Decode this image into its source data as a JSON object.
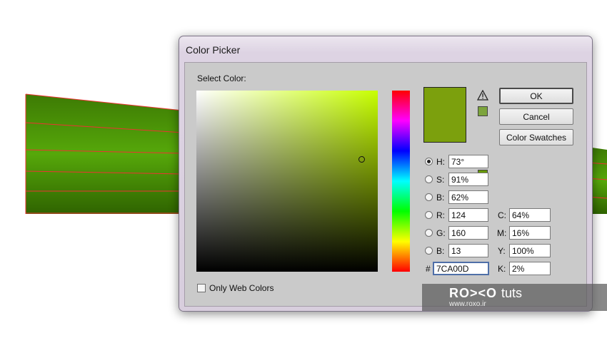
{
  "window": {
    "title": "Color Picker"
  },
  "picker": {
    "select_label": "Select Color:",
    "new_color": "#7CA00D",
    "gamut_swatch": "#7CA43C",
    "web_swatch": "#669900",
    "hue_deg": 73,
    "saturation_pct": 91,
    "brightness_pct": 62
  },
  "buttons": {
    "ok": "OK",
    "cancel": "Cancel",
    "swatches": "Color Swatches"
  },
  "hsb": {
    "h_label": "H:",
    "h_value": "73°",
    "s_label": "S:",
    "s_value": "91%",
    "b_label": "B:",
    "b_value": "62%"
  },
  "rgb": {
    "r_label": "R:",
    "r_value": "124",
    "g_label": "G:",
    "g_value": "160",
    "b_label": "B:",
    "b_value": "13"
  },
  "hex": {
    "label": "#",
    "value": "7CA00D"
  },
  "cmyk": {
    "c_label": "C:",
    "c_value": "64%",
    "m_label": "M:",
    "m_value": "16%",
    "y_label": "Y:",
    "y_value": "100%",
    "k_label": "K:",
    "k_value": "2%"
  },
  "only_web": {
    "label": "Only Web Colors",
    "checked": false
  },
  "watermark": {
    "logo": "RO><O",
    "tuts": "tuts",
    "url": "www.roxo.ir"
  },
  "icons": [
    "warning-icon",
    "cube-icon"
  ]
}
